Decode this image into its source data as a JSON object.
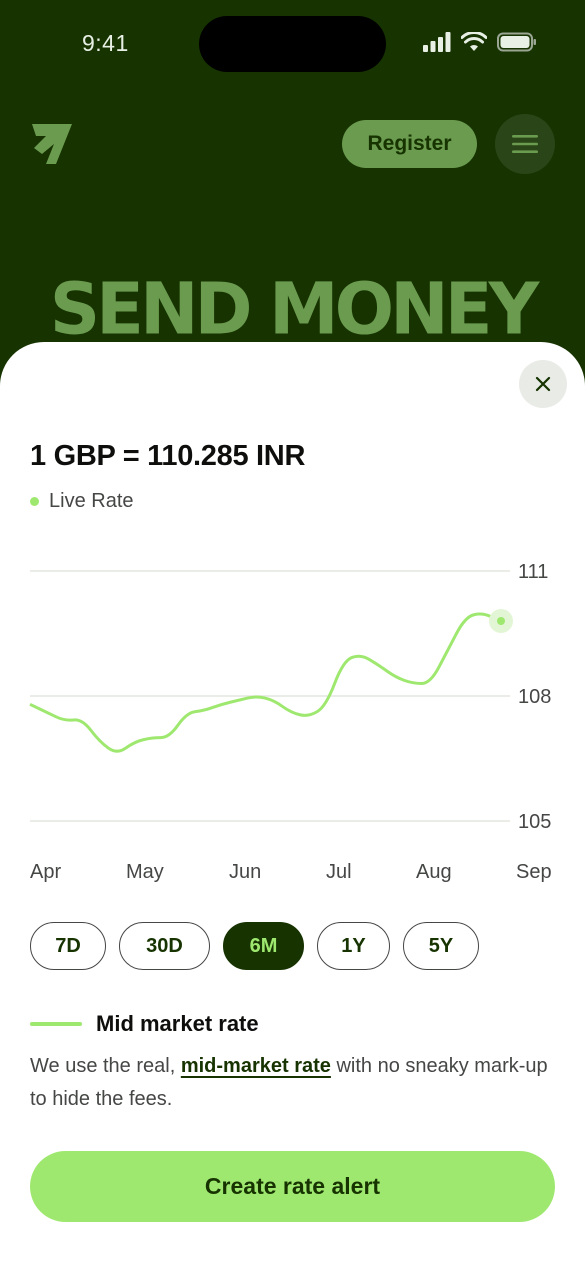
{
  "status_bar": {
    "time": "9:41"
  },
  "header": {
    "register_label": "Register"
  },
  "hero": {
    "title": "SEND MONEY"
  },
  "rate": {
    "title": "1 GBP = 110.285 INR",
    "live_label": "Live Rate"
  },
  "chart_data": {
    "type": "line",
    "x": [
      "Apr",
      "",
      "",
      "",
      "May",
      "",
      "",
      "",
      "Jun",
      "",
      "",
      "Jul",
      "",
      "",
      "",
      "Aug",
      "",
      "",
      ""
    ],
    "x_tick_labels": [
      "Apr",
      "May",
      "Jun",
      "Jul",
      "Aug",
      "Sep"
    ],
    "y_tick_labels": [
      "111",
      "108",
      "105"
    ],
    "ylim": [
      105,
      111
    ],
    "series": [
      {
        "values": [
          107.8,
          107.6,
          107.4,
          107.45,
          106.9,
          106.6,
          106.9,
          107.0,
          107.0,
          107.6,
          107.65,
          107.8,
          107.9,
          108.0,
          107.9,
          107.6,
          107.5,
          107.75,
          108.85,
          109.0,
          108.75,
          108.45,
          108.3,
          108.3,
          109.1,
          109.9,
          110.0,
          109.8
        ],
        "color": "#9fe870"
      }
    ],
    "last_point_value": 109.8,
    "grid": true
  },
  "periods": [
    {
      "label": "7D",
      "active": false
    },
    {
      "label": "30D",
      "active": false
    },
    {
      "label": "6M",
      "active": true
    },
    {
      "label": "1Y",
      "active": false
    },
    {
      "label": "5Y",
      "active": false
    }
  ],
  "legend": {
    "label": "Mid market rate"
  },
  "description": {
    "before": "We use the real, ",
    "link": "mid-market rate",
    "after": " with no sneaky mark-up to hide the fees."
  },
  "cta": {
    "label": "Create rate alert"
  },
  "colors": {
    "brand_dark": "#163300",
    "brand_light": "#9fe870",
    "brand_mid": "#6a9b4f"
  }
}
